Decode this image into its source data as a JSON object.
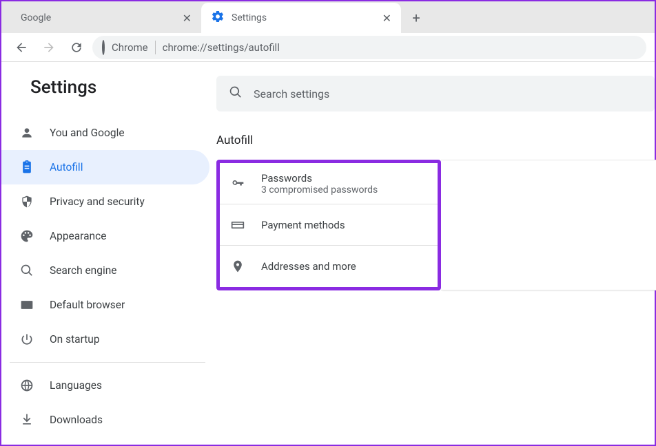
{
  "tabs": [
    {
      "title": "Google"
    },
    {
      "title": "Settings"
    }
  ],
  "address": {
    "label": "Chrome",
    "url": "chrome://settings/autofill"
  },
  "settings_title": "Settings",
  "search": {
    "placeholder": "Search settings"
  },
  "sidebar": {
    "items": [
      {
        "label": "You and Google"
      },
      {
        "label": "Autofill"
      },
      {
        "label": "Privacy and security"
      },
      {
        "label": "Appearance"
      },
      {
        "label": "Search engine"
      },
      {
        "label": "Default browser"
      },
      {
        "label": "On startup"
      },
      {
        "label": "Languages"
      },
      {
        "label": "Downloads"
      }
    ]
  },
  "main": {
    "section_title": "Autofill",
    "rows": [
      {
        "title": "Passwords",
        "subtitle": "3 compromised passwords"
      },
      {
        "title": "Payment methods"
      },
      {
        "title": "Addresses and more"
      }
    ]
  }
}
